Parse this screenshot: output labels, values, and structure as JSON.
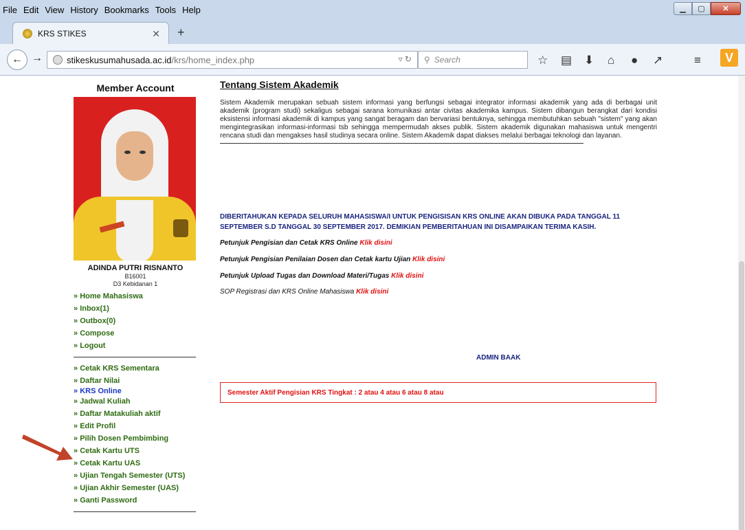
{
  "browser": {
    "menu": [
      "File",
      "Edit",
      "View",
      "History",
      "Bookmarks",
      "Tools",
      "Help"
    ],
    "tab_title": "KRS STIKES",
    "url_host": "stikeskusumahusada.ac.id",
    "url_path": "/krs/home_index.php",
    "search_placeholder": "Search"
  },
  "sidebar": {
    "title": "Member Account",
    "student_name": "ADINDA PUTRI RISNANTO",
    "student_id": "B16001",
    "program": "D3 Kebidanan 1",
    "nav_group1": [
      "Home Mahasiswa",
      "Inbox(1)",
      "Outbox(0)",
      "Compose",
      "Logout"
    ],
    "nav_group2": [
      "Cetak KRS Sementara",
      "Daftar Nilai",
      "KRS Online",
      "Jadwal Kuliah",
      "Daftar Matakuliah aktif",
      "Edit Profil",
      "Pilih Dosen Pembimbing",
      "Cetak Kartu UTS",
      "Cetak Kartu UAS",
      "Ujian Tengah Semester (UTS)",
      "Ujian Akhir Semester (UAS)",
      "Ganti Password"
    ]
  },
  "main": {
    "heading": "Tentang Sistem Akademik",
    "paragraph": "Sistem Akademik merupakan sebuah sistem informasi yang berfungsi sebagai integrator informasi akademik yang ada di berbagai unit akademik (program studi) sekaligus sebagai sarana komunikasi antar civitas akademika kampus. Sistem dibangun berangkat dari kondisi eksistensi informasi akademik di kampus yang sangat beragam dan bervariasi bentuknya, sehingga membutuhkan sebuah \"sistem\" yang akan mengintegrasikan informasi-informasi tsb sehingga mempermudah akses publik. Sistem akademik digunakan mahasiswa untuk mengentri rencana studi dan mengakses hasil studinya secara online. Sistem Akademik dapat diakses melalui berbagai teknologi dan layanan.",
    "notice": "DIBERITAHUKAN KEPADA SELURUH MAHASISWA/I UNTUK PENGISISAN KRS ONLINE AKAN DIBUKA PADA TANGGAL 11 SEPTEMBER S.D TANGGAL 30 SEPTEMBER 2017. DEMIKIAN PEMBERITAHUAN INI DISAMPAIKAN TERIMA KASIH.",
    "links": [
      {
        "text": "Petunjuk Pengisian dan Cetak KRS Online",
        "link": "Klik disini"
      },
      {
        "text": "Petunjuk Pengisian Penilaian Dosen dan Cetak kartu Ujian",
        "link": "Klik disini"
      },
      {
        "text": "Petunjuk Upload Tugas dan Download Materi/Tugas",
        "link": "Klik disini"
      },
      {
        "text": "SOP Registrasi dan KRS Online Mahasiswa",
        "link": "Klik disini"
      }
    ],
    "admin": "ADMIN BAAK",
    "semester_info": "Semester Aktif Pengisian KRS Tingkat : 2 atau 4 atau 6 atau 8 atau"
  },
  "colors": {
    "nav_green": "#2f6b12",
    "nav_active": "#1a37c6",
    "link_red": "#e01010",
    "notice_navy": "#1a237e",
    "annotation_arrow": "#c0432a"
  }
}
